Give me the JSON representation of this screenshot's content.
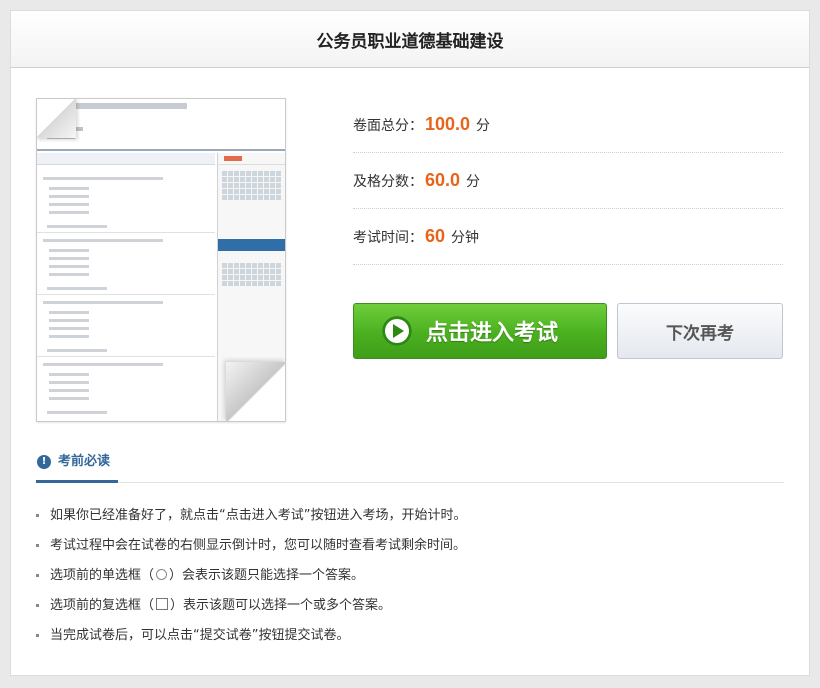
{
  "page": {
    "title": "公务员职业道德基础建设"
  },
  "info": {
    "total_label": "卷面总分：",
    "total_value": "100.0",
    "total_unit": "分",
    "pass_label": "及格分数：",
    "pass_value": "60.0",
    "pass_unit": "分",
    "time_label": "考试时间：",
    "time_value": "60",
    "time_unit": "分钟"
  },
  "buttons": {
    "start_label": "点击进入考试",
    "later_label": "下次再考"
  },
  "notice": {
    "title": "考前必读",
    "items": [
      "如果你已经准备好了，就点击“点击进入考试”按钮进入考场，开始计时。",
      "考试过程中会在试卷的右侧显示倒计时，您可以随时查看考试剩余时间。",
      {
        "before": "选项前的单选框（",
        "after": "）会表示该题只能选择一个答案。"
      },
      {
        "before": "选项前的复选框（",
        "after": "）表示该题可以选择一个或多个答案。"
      },
      "当完成试卷后，可以点击“提交试卷”按钮提交试卷。"
    ]
  },
  "icons": {
    "play": "play-circle-icon",
    "info": "info-circle-icon",
    "radio": "radio-sample-icon",
    "checkbox": "checkbox-sample-icon"
  },
  "colors": {
    "accent_orange": "#e8641b",
    "start_green": "#4ab01f",
    "notice_blue": "#34689b"
  }
}
